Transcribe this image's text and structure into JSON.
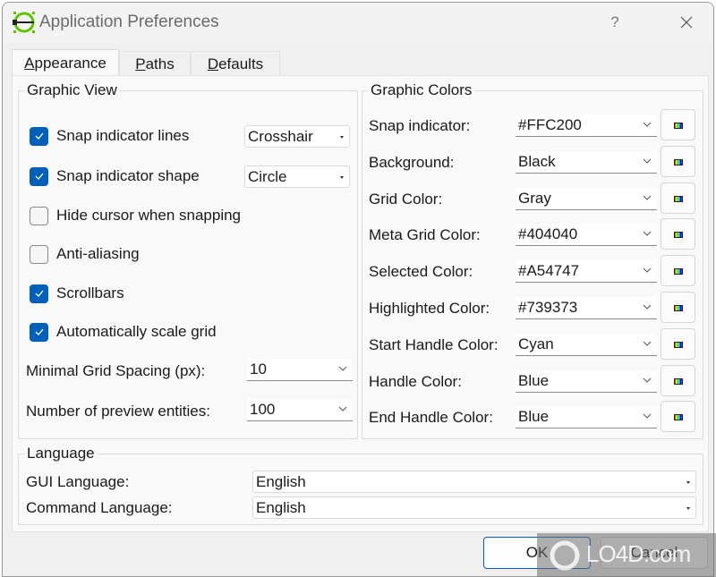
{
  "window": {
    "title": "Application Preferences",
    "help_label": "?",
    "icons": {
      "app": "app-logo-icon",
      "close": "close-icon"
    }
  },
  "tabs": [
    {
      "label": "Appearance",
      "mnemonic": "A",
      "active": true
    },
    {
      "label": "Paths",
      "mnemonic": "P",
      "active": false
    },
    {
      "label": "Defaults",
      "mnemonic": "D",
      "active": false
    }
  ],
  "graphic_view": {
    "title": "Graphic View",
    "options": [
      {
        "label": "Snap indicator lines",
        "checked": true,
        "select": "Crosshair"
      },
      {
        "label": "Snap indicator shape",
        "checked": true,
        "select": "Circle"
      },
      {
        "label": "Hide cursor when snapping",
        "checked": false
      },
      {
        "label": "Anti-aliasing",
        "checked": false
      },
      {
        "label": "Scrollbars",
        "checked": true
      },
      {
        "label": "Automatically scale grid",
        "checked": true
      }
    ],
    "min_grid_spacing": {
      "label": "Minimal Grid Spacing (px):",
      "value": "10"
    },
    "preview_entities": {
      "label": "Number of preview entities:",
      "value": "100"
    }
  },
  "graphic_colors": {
    "title": "Graphic Colors",
    "rows": [
      {
        "label": "Snap indicator:",
        "value": "#FFC200"
      },
      {
        "label": "Background:",
        "value": "Black"
      },
      {
        "label": "Grid Color:",
        "value": "Gray"
      },
      {
        "label": "Meta Grid Color:",
        "value": "#404040"
      },
      {
        "label": "Selected Color:",
        "value": "#A54747"
      },
      {
        "label": "Highlighted Color:",
        "value": "#739373"
      },
      {
        "label": "Start Handle Color:",
        "value": "Cyan"
      },
      {
        "label": "Handle Color:",
        "value": "Blue"
      },
      {
        "label": "End Handle Color:",
        "value": "Blue"
      }
    ],
    "picker_icon": "color-palette-icon"
  },
  "language": {
    "title": "Language",
    "gui": {
      "label": "GUI Language:",
      "value": "English"
    },
    "command": {
      "label": "Command Language:",
      "value": "English"
    }
  },
  "buttons": {
    "ok": "OK",
    "cancel": "Cancel"
  },
  "watermark": {
    "text": "LO4D.com"
  },
  "colors": {
    "accent": "#005fb8",
    "icon_green": "#5fc400"
  }
}
